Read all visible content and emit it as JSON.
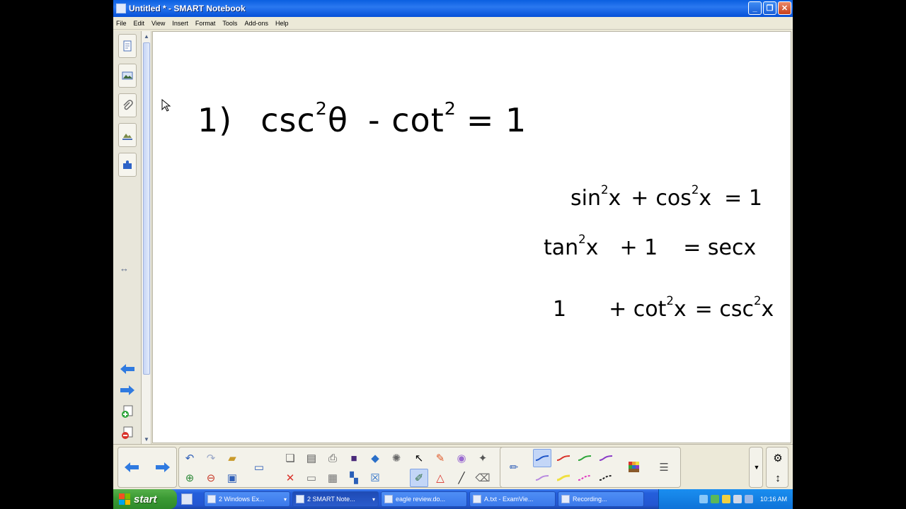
{
  "window": {
    "title": "Untitled * - SMART Notebook"
  },
  "menu": [
    "File",
    "Edit",
    "View",
    "Insert",
    "Format",
    "Tools",
    "Add-ons",
    "Help"
  ],
  "canvas": {
    "eq_main": {
      "prefix": "1)",
      "a": "csc",
      "a_exp": "2",
      "theta": "θ",
      "b": "- cot",
      "b_exp": "2",
      "rhs": "= 1"
    },
    "eq_1": {
      "a": "sin",
      "a_exp": "2",
      "a_var": "x",
      "op": "+",
      "b": "cos",
      "b_exp": "2",
      "b_var": "x",
      "rhs": "= 1"
    },
    "eq_2": {
      "a": "tan",
      "a_exp": "2",
      "a_var": "x",
      "op": "+ 1",
      "rhs": "= secx"
    },
    "eq_3": {
      "a": "1",
      "op": "+ cot",
      "b_exp": "2",
      "b_var": "x",
      "eq": "= csc",
      "c_exp": "2",
      "c_var": "x"
    }
  },
  "taskbar": {
    "start_label": "start",
    "tasks": [
      {
        "label": "2 Windows Ex..."
      },
      {
        "label": "2 SMART Note..."
      },
      {
        "label": "eagle review.do..."
      },
      {
        "label": "A.txt - ExamVie..."
      },
      {
        "label": "Recording..."
      }
    ],
    "clock": "10:16 AM"
  },
  "colors": {
    "titlebar": "#0a5fe0",
    "taskbar": "#245edb",
    "start": "#3b9a34",
    "tray": "#0f73d8"
  }
}
